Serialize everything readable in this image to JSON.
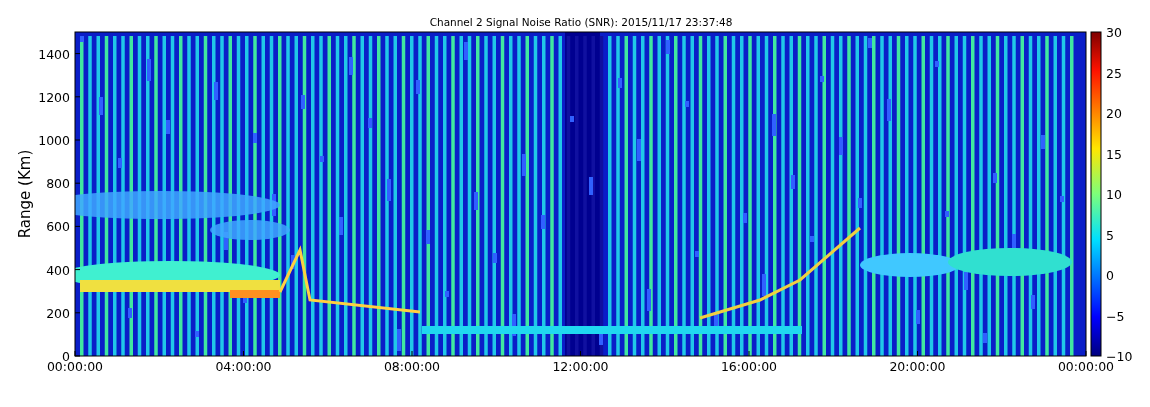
{
  "title": "Channel 2 Signal Noise Ratio (SNR): 2015/11/17 23:37:48",
  "plot": {
    "ylabel": "Range (Km)",
    "x_ticks": [
      "00:00:00",
      "04:00:00",
      "08:00:00",
      "12:00:00",
      "16:00:00",
      "20:00:00",
      "00:00:00"
    ],
    "y_ticks": [
      "1400",
      "1200",
      "1000",
      "800",
      "600",
      "400",
      "200",
      "0"
    ]
  },
  "colorbar": {
    "ticks": [
      "30",
      "25",
      "20",
      "15",
      "10",
      "5",
      "0",
      "−5",
      "−10"
    ]
  }
}
